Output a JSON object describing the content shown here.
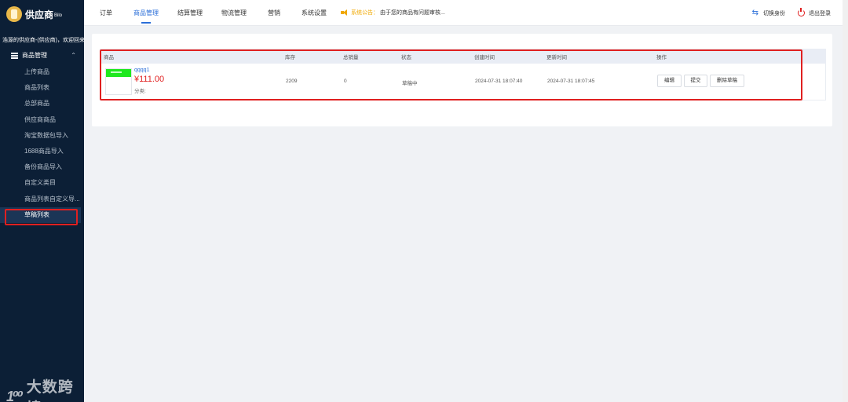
{
  "sidebar": {
    "logo_text": "供应商",
    "logo_sub": "Bilo",
    "welcome": "浩源的供应商-(供应商)，欢迎回来",
    "menu_title": "商品管理",
    "items": [
      {
        "label": "上传商品"
      },
      {
        "label": "商品列表"
      },
      {
        "label": "总部商品"
      },
      {
        "label": "供应商商品"
      },
      {
        "label": "淘宝数据包导入"
      },
      {
        "label": "1688商品导入"
      },
      {
        "label": "备份商品导入"
      },
      {
        "label": "自定义类目"
      },
      {
        "label": "商品列表自定义导..."
      },
      {
        "label": "草稿列表",
        "active": true
      }
    ]
  },
  "watermark": {
    "logo": "1⁰⁰",
    "text": "大数跨境"
  },
  "topbar": {
    "tabs": [
      "订单",
      "商品管理",
      "结算管理",
      "物流管理",
      "营销",
      "系统设置"
    ],
    "notice_label": "系统公告：",
    "notice_text": "由于您的商品有问题审核...",
    "switch_label": "切换身份",
    "logout_label": "退出登录"
  },
  "table": {
    "headers": {
      "product": "商品",
      "stock": "库存",
      "sales": "总销量",
      "status": "状态",
      "created": "创建时间",
      "updated": "更新时间",
      "actions": "操作"
    },
    "row": {
      "name": "qqqq1",
      "price": "¥111.00",
      "category": "分类:",
      "stock": "2209",
      "sales": "0",
      "status": "草稿中",
      "created": "2024-07-31 18:07:40",
      "updated": "2024-07-31 18:07:45",
      "btn_edit": "编辑",
      "btn_submit": "提交",
      "btn_delete": "删除草稿"
    }
  },
  "colors": {
    "sidebar_bg": "#0c1f36",
    "accent": "#2a6ed8",
    "highlight": "#e02020",
    "notice": "#f0a800"
  }
}
